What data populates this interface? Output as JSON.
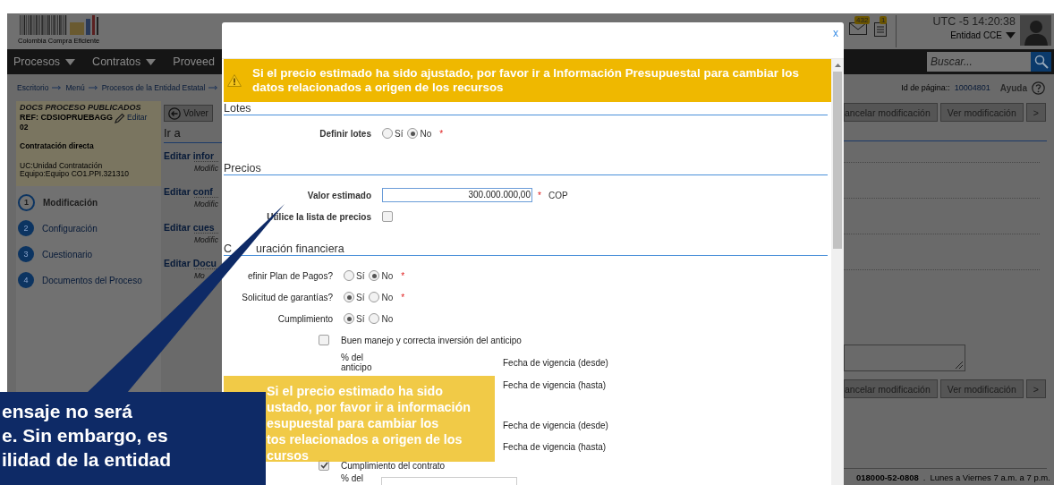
{
  "header": {
    "logo_text": "Colombia Compra Eficiente",
    "mail_count": "432",
    "notice_count": "1",
    "clock": "UTC -5 14:20:38",
    "entity": "Entidad CCE",
    "search": {
      "placeholder": "Buscar..."
    }
  },
  "nav": [
    {
      "label": "Procesos",
      "dropdown": true
    },
    {
      "label": "Contratos",
      "dropdown": true
    },
    {
      "label": "Proveed",
      "dropdown": false
    }
  ],
  "breadcrumb": [
    "Escritorio",
    "Menú",
    "Procesos de la Entidad Estatal"
  ],
  "page_id": {
    "label": "Id de página::",
    "value": "10004801"
  },
  "help": "Ayuda",
  "process_card": {
    "title": "DOCS PROCESO PUBLICADOS",
    "ref": "REF: CDSIOPRUEBAGG",
    "edit": "Editar",
    "ref_suffix": "02",
    "type": "Contratación directa",
    "unit": "UC:Unidad Contratación",
    "team": "Equipo:Equipo CO1.PPI.321310"
  },
  "steps": [
    {
      "number": "1",
      "label": "Modificación",
      "selected": true
    },
    {
      "number": "2",
      "label": "Configuración",
      "selected": false
    },
    {
      "number": "3",
      "label": "Cuestionario",
      "selected": false
    },
    {
      "number": "4",
      "label": "Documentos del Proceso",
      "selected": false
    }
  ],
  "back_button": "Volver",
  "goto_title": "Ir a",
  "goto_links": [
    {
      "title": "Editar infor",
      "subtitle": "Modific"
    },
    {
      "title": "Editar conf",
      "subtitle": "Modific"
    },
    {
      "title": "Editar cues",
      "subtitle": "Modific"
    },
    {
      "title": "Editar Docu",
      "subtitle": "Mo"
    }
  ],
  "action_buttons_top": [
    "ancelar modificación",
    "Ver modificación",
    ">"
  ],
  "action_buttons_bottom": [
    "ancelar modificación",
    "Ver modificación",
    ">"
  ],
  "footer": {
    "phone": "018000-52-0808",
    "separator": ".",
    "hours": "Lunes a Viernes 7 a.m. a 7 p.m."
  },
  "modal": {
    "close": "x",
    "banner": "Si el precio estimado ha sido ajustado, por favor ir a Información Presupuestal para cambiar los datos relacionados a origen de los recursos",
    "lotes": {
      "title": "Lotes",
      "rows": [
        {
          "kind": "radio",
          "label": "Definir lotes",
          "options": [
            {
              "label": "Sí",
              "selected": false
            },
            {
              "label": "No",
              "selected": true
            }
          ],
          "required_mark": "*"
        }
      ]
    },
    "precios": {
      "title": "Precios",
      "rows": [
        {
          "kind": "input",
          "label": "Valor estimado",
          "value": "300.000.000,00",
          "required_mark": "*",
          "unit": "COP"
        },
        {
          "kind": "checkbox",
          "label": "Utilice la lista de precios",
          "checked": false
        }
      ]
    },
    "finance": {
      "title_start": "C",
      "title_end": "uración financiera",
      "groups": [
        [
          {
            "kind": "radio",
            "label": "efinir Plan de Pagos?",
            "options": [
              {
                "label": "Sí",
                "selected": false
              },
              {
                "label": "No",
                "selected": true
              }
            ],
            "required_mark": "*"
          },
          {
            "kind": "radio",
            "label": "Solicitud de garantías?",
            "options": [
              {
                "label": "Sí",
                "selected": true
              },
              {
                "label": "No",
                "selected": false
              }
            ],
            "required_mark": "*"
          },
          {
            "kind": "radio",
            "label": "Cumplimiento",
            "options": [
              {
                "label": "Sí",
                "selected": true
              },
              {
                "label": "No",
                "selected": false
              }
            ]
          },
          {
            "kind": "check_option",
            "label": "Buen manejo y correcta inversión del anticipo",
            "checked": false
          },
          {
            "kind": "amount",
            "label": "% del anticipo",
            "date": "Fecha de vigencia (desde)"
          },
          {
            "kind": "date",
            "date": "Fecha de vigencia (hasta)"
          }
        ],
        [
          {
            "kind": "date",
            "date": "Fecha de vigencia (desde)"
          },
          {
            "kind": "date",
            "date": "Fecha de vigencia (hasta)"
          },
          {
            "kind": "check_option",
            "label": "Cumplimiento del contrato",
            "checked": true
          },
          {
            "kind": "amount_field",
            "label": "% del"
          }
        ]
      ]
    }
  },
  "note": {
    "lines": [
      "Si el precio estimado ha sido",
      "ustado, por favor ir a información",
      "esupuestal para cambiar los",
      "tos relacionados a origen de los",
      "cursos"
    ]
  },
  "callout": {
    "lines": [
      "ensaje no será",
      "e. Sin embargo, es",
      "ilidad de la entidad"
    ]
  }
}
